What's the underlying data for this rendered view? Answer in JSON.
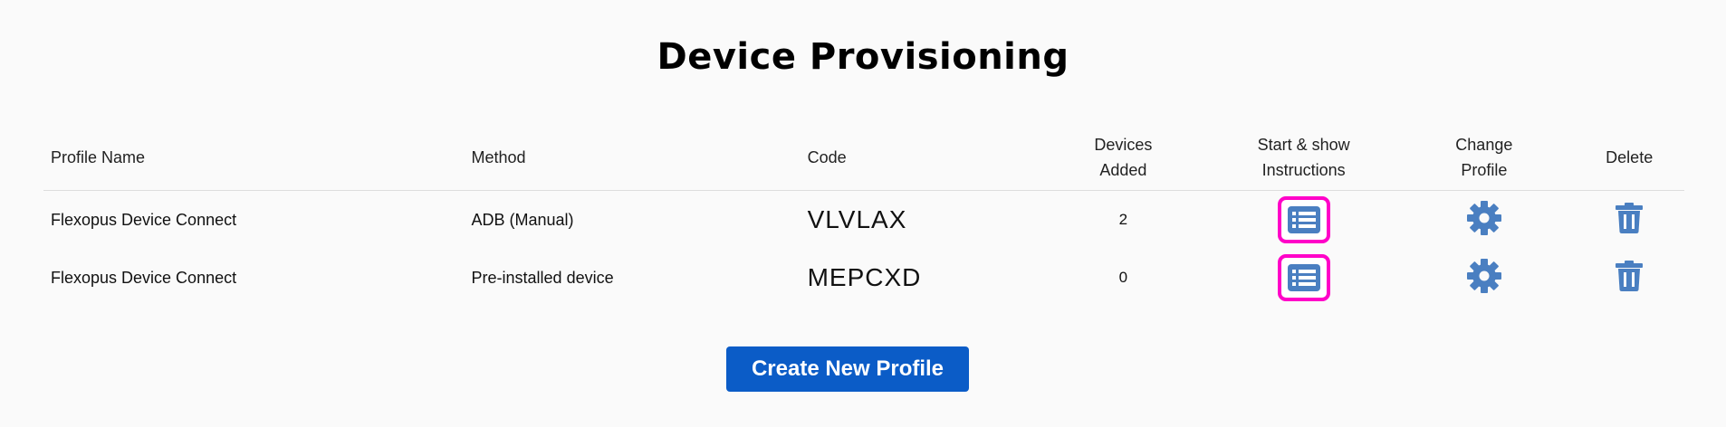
{
  "page": {
    "title": "Device Provisioning"
  },
  "table": {
    "headers": {
      "profile_name": "Profile Name",
      "method": "Method",
      "code": "Code",
      "devices_added_line1": "Devices",
      "devices_added_line2": "Added",
      "start_line1": "Start & show",
      "start_line2": "Instructions",
      "change_line1": "Change",
      "change_line2": "Profile",
      "delete": "Delete"
    },
    "rows": [
      {
        "profile_name": "Flexopus Device Connect",
        "method": "ADB (Manual)",
        "code": "VLVLAX",
        "devices_added": "2"
      },
      {
        "profile_name": "Flexopus Device Connect",
        "method": "Pre-installed device",
        "code": "MEPCXD",
        "devices_added": "0"
      }
    ]
  },
  "icons": {
    "start": "list-icon",
    "change": "gear-icon",
    "delete": "trash-icon"
  },
  "actions": {
    "create_label": "Create New Profile"
  },
  "colors": {
    "icon_blue": "#4a7fc1",
    "highlight_magenta": "#ff00c8",
    "primary_button": "#0b5cc7"
  }
}
